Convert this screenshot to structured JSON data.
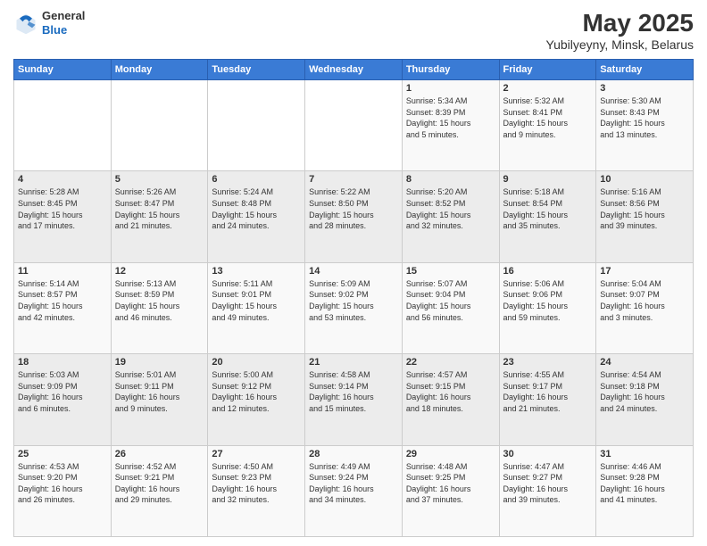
{
  "header": {
    "logo": {
      "line1": "General",
      "line2": "Blue"
    },
    "title": "May 2025",
    "subtitle": "Yubilyeyny, Minsk, Belarus"
  },
  "weekdays": [
    "Sunday",
    "Monday",
    "Tuesday",
    "Wednesday",
    "Thursday",
    "Friday",
    "Saturday"
  ],
  "weeks": [
    [
      {
        "day": "",
        "info": ""
      },
      {
        "day": "",
        "info": ""
      },
      {
        "day": "",
        "info": ""
      },
      {
        "day": "",
        "info": ""
      },
      {
        "day": "1",
        "info": "Sunrise: 5:34 AM\nSunset: 8:39 PM\nDaylight: 15 hours\nand 5 minutes."
      },
      {
        "day": "2",
        "info": "Sunrise: 5:32 AM\nSunset: 8:41 PM\nDaylight: 15 hours\nand 9 minutes."
      },
      {
        "day": "3",
        "info": "Sunrise: 5:30 AM\nSunset: 8:43 PM\nDaylight: 15 hours\nand 13 minutes."
      }
    ],
    [
      {
        "day": "4",
        "info": "Sunrise: 5:28 AM\nSunset: 8:45 PM\nDaylight: 15 hours\nand 17 minutes."
      },
      {
        "day": "5",
        "info": "Sunrise: 5:26 AM\nSunset: 8:47 PM\nDaylight: 15 hours\nand 21 minutes."
      },
      {
        "day": "6",
        "info": "Sunrise: 5:24 AM\nSunset: 8:48 PM\nDaylight: 15 hours\nand 24 minutes."
      },
      {
        "day": "7",
        "info": "Sunrise: 5:22 AM\nSunset: 8:50 PM\nDaylight: 15 hours\nand 28 minutes."
      },
      {
        "day": "8",
        "info": "Sunrise: 5:20 AM\nSunset: 8:52 PM\nDaylight: 15 hours\nand 32 minutes."
      },
      {
        "day": "9",
        "info": "Sunrise: 5:18 AM\nSunset: 8:54 PM\nDaylight: 15 hours\nand 35 minutes."
      },
      {
        "day": "10",
        "info": "Sunrise: 5:16 AM\nSunset: 8:56 PM\nDaylight: 15 hours\nand 39 minutes."
      }
    ],
    [
      {
        "day": "11",
        "info": "Sunrise: 5:14 AM\nSunset: 8:57 PM\nDaylight: 15 hours\nand 42 minutes."
      },
      {
        "day": "12",
        "info": "Sunrise: 5:13 AM\nSunset: 8:59 PM\nDaylight: 15 hours\nand 46 minutes."
      },
      {
        "day": "13",
        "info": "Sunrise: 5:11 AM\nSunset: 9:01 PM\nDaylight: 15 hours\nand 49 minutes."
      },
      {
        "day": "14",
        "info": "Sunrise: 5:09 AM\nSunset: 9:02 PM\nDaylight: 15 hours\nand 53 minutes."
      },
      {
        "day": "15",
        "info": "Sunrise: 5:07 AM\nSunset: 9:04 PM\nDaylight: 15 hours\nand 56 minutes."
      },
      {
        "day": "16",
        "info": "Sunrise: 5:06 AM\nSunset: 9:06 PM\nDaylight: 15 hours\nand 59 minutes."
      },
      {
        "day": "17",
        "info": "Sunrise: 5:04 AM\nSunset: 9:07 PM\nDaylight: 16 hours\nand 3 minutes."
      }
    ],
    [
      {
        "day": "18",
        "info": "Sunrise: 5:03 AM\nSunset: 9:09 PM\nDaylight: 16 hours\nand 6 minutes."
      },
      {
        "day": "19",
        "info": "Sunrise: 5:01 AM\nSunset: 9:11 PM\nDaylight: 16 hours\nand 9 minutes."
      },
      {
        "day": "20",
        "info": "Sunrise: 5:00 AM\nSunset: 9:12 PM\nDaylight: 16 hours\nand 12 minutes."
      },
      {
        "day": "21",
        "info": "Sunrise: 4:58 AM\nSunset: 9:14 PM\nDaylight: 16 hours\nand 15 minutes."
      },
      {
        "day": "22",
        "info": "Sunrise: 4:57 AM\nSunset: 9:15 PM\nDaylight: 16 hours\nand 18 minutes."
      },
      {
        "day": "23",
        "info": "Sunrise: 4:55 AM\nSunset: 9:17 PM\nDaylight: 16 hours\nand 21 minutes."
      },
      {
        "day": "24",
        "info": "Sunrise: 4:54 AM\nSunset: 9:18 PM\nDaylight: 16 hours\nand 24 minutes."
      }
    ],
    [
      {
        "day": "25",
        "info": "Sunrise: 4:53 AM\nSunset: 9:20 PM\nDaylight: 16 hours\nand 26 minutes."
      },
      {
        "day": "26",
        "info": "Sunrise: 4:52 AM\nSunset: 9:21 PM\nDaylight: 16 hours\nand 29 minutes."
      },
      {
        "day": "27",
        "info": "Sunrise: 4:50 AM\nSunset: 9:23 PM\nDaylight: 16 hours\nand 32 minutes."
      },
      {
        "day": "28",
        "info": "Sunrise: 4:49 AM\nSunset: 9:24 PM\nDaylight: 16 hours\nand 34 minutes."
      },
      {
        "day": "29",
        "info": "Sunrise: 4:48 AM\nSunset: 9:25 PM\nDaylight: 16 hours\nand 37 minutes."
      },
      {
        "day": "30",
        "info": "Sunrise: 4:47 AM\nSunset: 9:27 PM\nDaylight: 16 hours\nand 39 minutes."
      },
      {
        "day": "31",
        "info": "Sunrise: 4:46 AM\nSunset: 9:28 PM\nDaylight: 16 hours\nand 41 minutes."
      }
    ]
  ]
}
